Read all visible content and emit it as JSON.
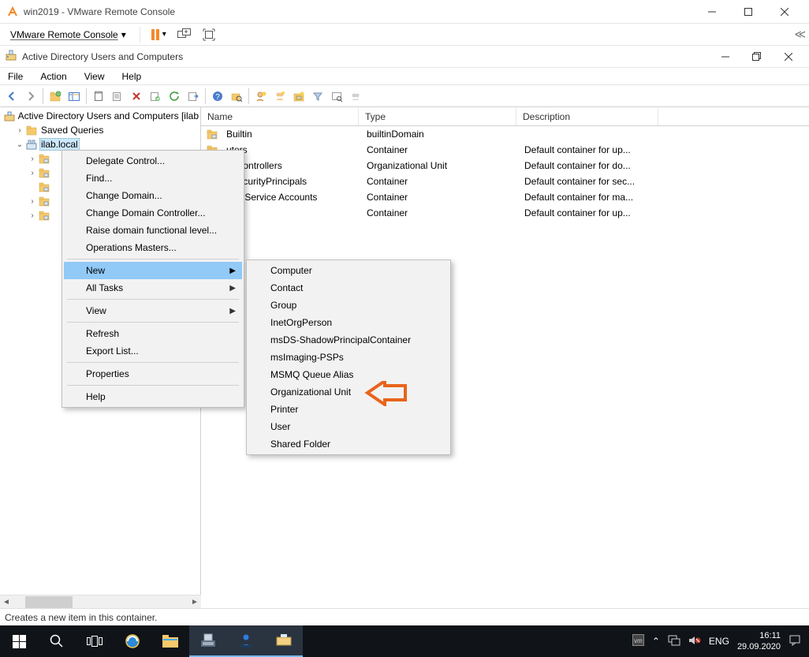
{
  "vmware": {
    "title": "win2019 - VMware Remote Console",
    "menu_label": "VMware Remote Console"
  },
  "ad": {
    "title": "Active Directory Users and Computers",
    "menus": {
      "file": "File",
      "action": "Action",
      "view": "View",
      "help": "Help"
    },
    "tree": {
      "root": "Active Directory Users and Computers [ilab",
      "saved": "Saved Queries",
      "domain": "ilab.local"
    },
    "columns": {
      "name": "Name",
      "type": "Type",
      "desc": "Description"
    },
    "rows": [
      {
        "name": "Builtin",
        "type": "builtinDomain",
        "desc": ""
      },
      {
        "name": "uters",
        "type": "Container",
        "desc": "Default container for up..."
      },
      {
        "name": "in Controllers",
        "type": "Organizational Unit",
        "desc": "Default container for do..."
      },
      {
        "name": "nSecurityPrincipals",
        "type": "Container",
        "desc": "Default container for sec..."
      },
      {
        "name": "ged Service Accounts",
        "type": "Container",
        "desc": "Default container for ma..."
      },
      {
        "name": "",
        "type": "Container",
        "desc": "Default container for up..."
      }
    ],
    "status": "Creates a new item in this container."
  },
  "context1": {
    "items": [
      "Delegate Control...",
      "Find...",
      "Change Domain...",
      "Change Domain Controller...",
      "Raise domain functional level...",
      "Operations Masters...",
      "New",
      "All Tasks",
      "View",
      "Refresh",
      "Export List...",
      "Properties",
      "Help"
    ]
  },
  "context2": {
    "items": [
      "Computer",
      "Contact",
      "Group",
      "InetOrgPerson",
      "msDS-ShadowPrincipalContainer",
      "msImaging-PSPs",
      "MSMQ Queue Alias",
      "Organizational Unit",
      "Printer",
      "User",
      "Shared Folder"
    ]
  },
  "tray": {
    "lang": "ENG",
    "time": "16:11",
    "date": "29.09.2020"
  }
}
